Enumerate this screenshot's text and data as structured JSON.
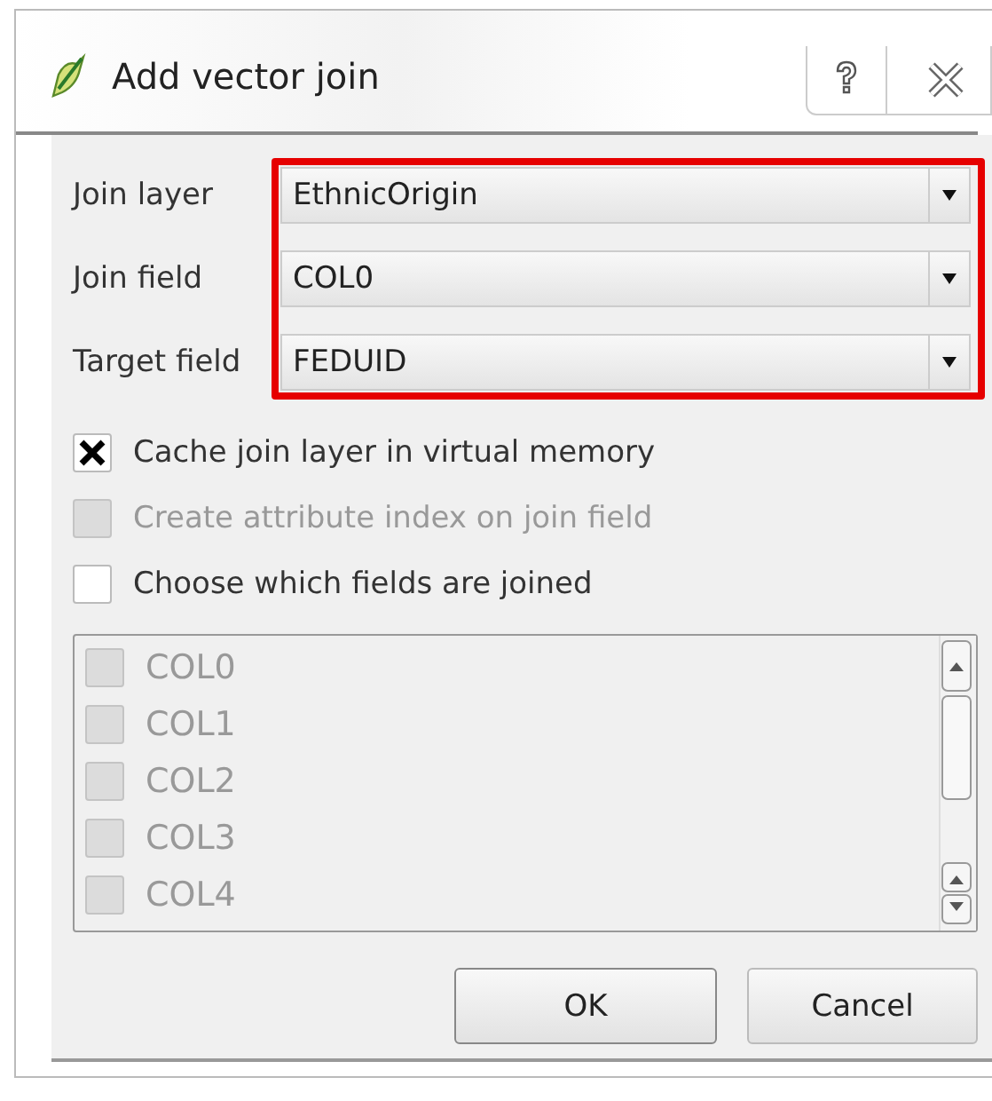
{
  "window": {
    "title": "Add vector join"
  },
  "form": [
    {
      "label": "Join layer",
      "value": "EthnicOrigin"
    },
    {
      "label": "Join field",
      "value": "COL0"
    },
    {
      "label": "Target field",
      "value": "FEDUID"
    }
  ],
  "options": [
    {
      "label": "Cache join layer in virtual memory",
      "checked": true,
      "disabled": false
    },
    {
      "label": "Create attribute index on join field",
      "checked": false,
      "disabled": true
    },
    {
      "label": "Choose which fields are joined",
      "checked": false,
      "disabled": false
    }
  ],
  "fields": [
    {
      "label": "COL0",
      "checked": false,
      "disabled": true
    },
    {
      "label": "COL1",
      "checked": false,
      "disabled": true
    },
    {
      "label": "COL2",
      "checked": false,
      "disabled": true
    },
    {
      "label": "COL3",
      "checked": false,
      "disabled": true
    },
    {
      "label": "COL4",
      "checked": false,
      "disabled": true
    }
  ],
  "buttons": [
    "OK",
    "Cancel"
  ]
}
